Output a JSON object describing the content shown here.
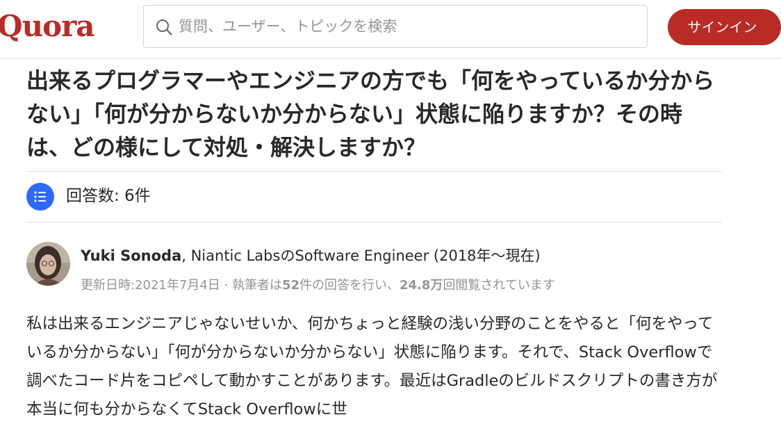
{
  "header": {
    "logo": "Quora",
    "search_placeholder": "質問、ユーザー、トピックを検索",
    "signin_label": "サインイン",
    "brand_color": "#b92b27"
  },
  "question": {
    "title": "出来るプログラマーやエンジニアの方でも「何をやっているか分からない」「何が分からないか分からない」状態に陥りますか？その時は、どの様にして対処・解決しますか？"
  },
  "answers": {
    "count_label": "回答数: 6件",
    "icon": "list-icon"
  },
  "answer": {
    "author_name": "Yuki Sonoda",
    "author_credential": ", Niantic LabsのSoftware Engineer (2018年〜現在)",
    "meta_prefix": "更新日時:2021年7月4日 · 執筆者は",
    "meta_answers": "52",
    "meta_mid": "件の回答を行い、",
    "meta_views": "24.8万",
    "meta_suffix": "回閲覧されています",
    "body": "私は出来るエンジニアじゃないせいか、何かちょっと経験の浅い分野のことをやると「何をやっているか分からない」「何が分からないか分からない」状態に陥ります。それで、Stack Overflowで調べたコード片をコピペして動かすことがあります。最近はGradleのビルドスクリプトの書き方が本当に何も分からなくてStack Overflowに世"
  }
}
